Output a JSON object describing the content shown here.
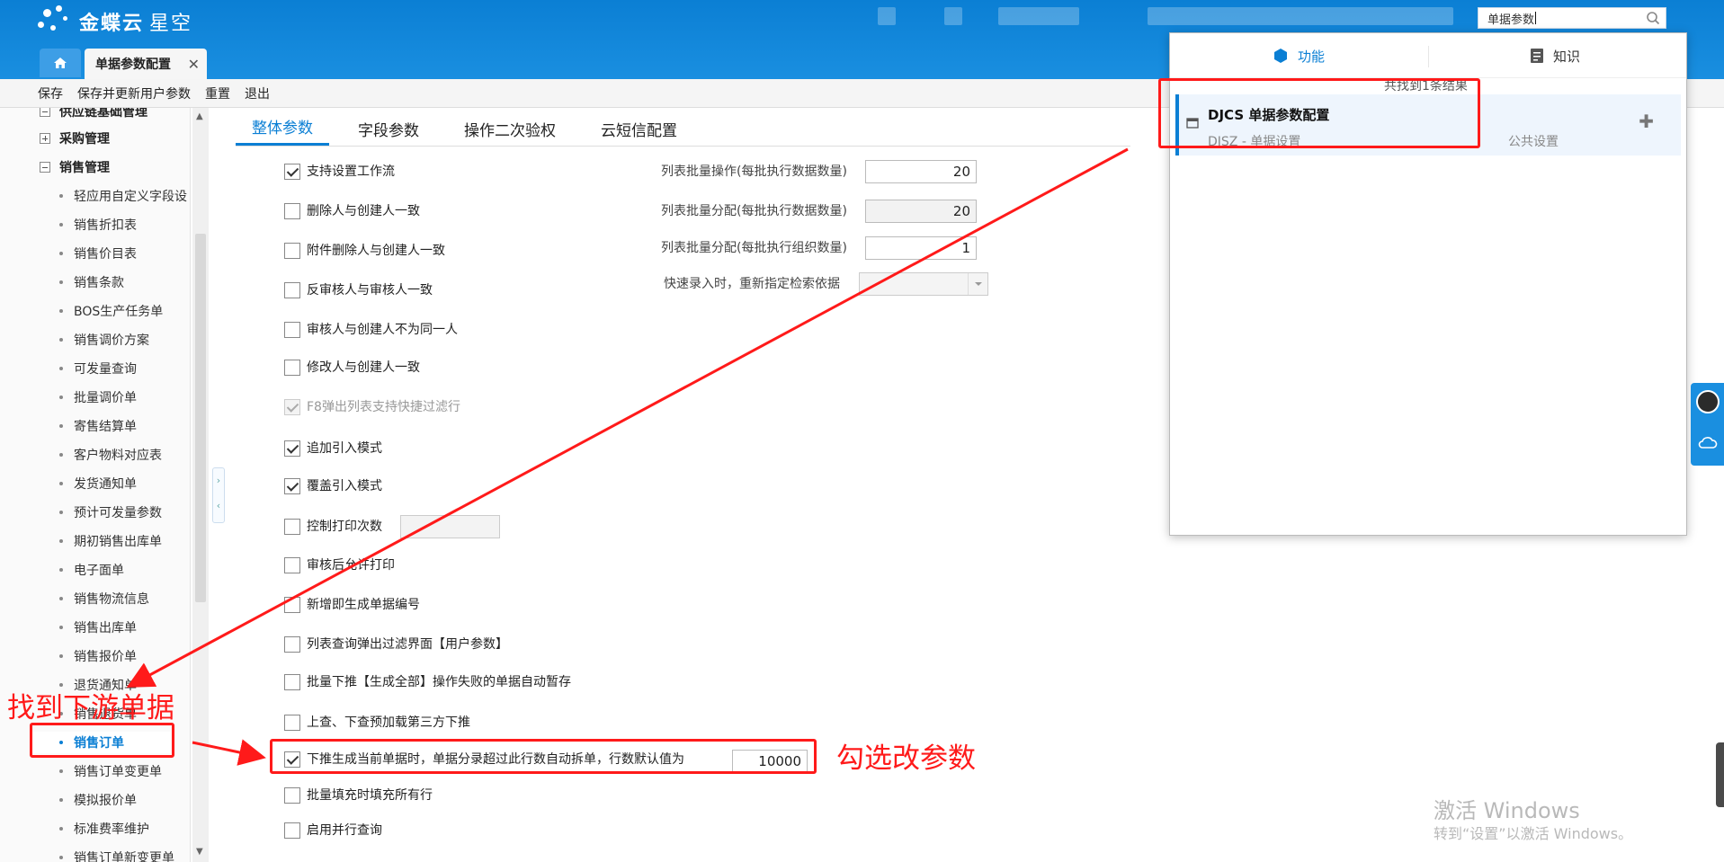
{
  "header": {
    "app_name": "金蝶云",
    "app_suffix": "星空",
    "search_value": "单据参数",
    "tabs": [
      {
        "label": "单据参数配置",
        "active": true
      }
    ]
  },
  "toolbar": {
    "items": [
      "保存",
      "保存并更新用户参数",
      "重置",
      "退出"
    ]
  },
  "sidebar": {
    "groups": [
      {
        "label": "供应链基础管理",
        "expanded": true
      },
      {
        "label": "采购管理",
        "expanded": false
      },
      {
        "label": "销售管理",
        "expanded": true
      }
    ],
    "items": [
      "轻应用自定义字段设",
      "销售折扣表",
      "销售价目表",
      "销售条款",
      "BOS生产任务单",
      "销售调价方案",
      "可发量查询",
      "批量调价单",
      "寄售结算单",
      "客户物料对应表",
      "发货通知单",
      "预计可发量参数",
      "期初销售出库单",
      "电子面单",
      "销售物流信息",
      "销售出库单",
      "销售报价单",
      "退货通知单",
      "销售退货单",
      "销售订单",
      "销售订单变更单",
      "模拟报价单",
      "标准费率维护",
      "销售订单新变更单"
    ],
    "active_item": "销售订单"
  },
  "main": {
    "tabs": [
      "整体参数",
      "字段参数",
      "操作二次验权",
      "云短信配置"
    ],
    "options": [
      {
        "label": "支持设置工作流",
        "checked": true
      },
      {
        "label": "删除人与创建人一致",
        "checked": false
      },
      {
        "label": "附件删除人与创建人一致",
        "checked": false
      },
      {
        "label": "反审核人与审核人一致",
        "checked": false
      },
      {
        "label": "审核人与创建人不为同一人",
        "checked": false
      },
      {
        "label": "修改人与创建人一致",
        "checked": false
      },
      {
        "label": "F8弹出列表支持快捷过滤行",
        "checked": true,
        "disabled": true
      },
      {
        "label": "追加引入模式",
        "checked": true
      },
      {
        "label": "覆盖引入模式",
        "checked": true
      },
      {
        "label": "控制打印次数",
        "checked": false
      },
      {
        "label": "审核后允许打印",
        "checked": false
      },
      {
        "label": "新增即生成单据编号",
        "checked": false
      },
      {
        "label": "列表查询弹出过滤界面【用户参数】",
        "checked": false
      },
      {
        "label": "批量下推【生成全部】操作失败的单据自动暂存",
        "checked": false
      },
      {
        "label": "上查、下查预加载第三方下推",
        "checked": false
      },
      {
        "label": "下推生成当前单据时，单据分录超过此行数自动拆单，行数默认值为",
        "checked": true
      },
      {
        "label": "批量填充时填充所有行",
        "checked": false
      },
      {
        "label": "启用并行查询",
        "checked": false
      }
    ],
    "split_rows_value": "10000",
    "params": [
      {
        "label": "列表批量操作(每批执行数据数量)",
        "value": "20"
      },
      {
        "label": "列表批量分配(每批执行数据数量)",
        "value": "20"
      },
      {
        "label": "列表批量分配(每批执行组织数量)",
        "value": "1"
      },
      {
        "label": "快速录入时，重新指定检索依据",
        "value": ""
      }
    ]
  },
  "popup": {
    "tabs": [
      "功能",
      "知识"
    ],
    "count_text": "共找到1条结果",
    "result": {
      "title": "DJCS 单据参数配置",
      "subtitle": "DJSZ - 单据设置",
      "category": "公共设置"
    }
  },
  "annotations": {
    "find_downstream": "找到下游单据",
    "check_param": "勾选改参数"
  },
  "watermark": {
    "line1": "激活 Windows",
    "line2": "转到“设置”以激活 Windows。"
  },
  "colors": {
    "brand": "#0b7fd4",
    "annotation": "#ff1a1a"
  }
}
